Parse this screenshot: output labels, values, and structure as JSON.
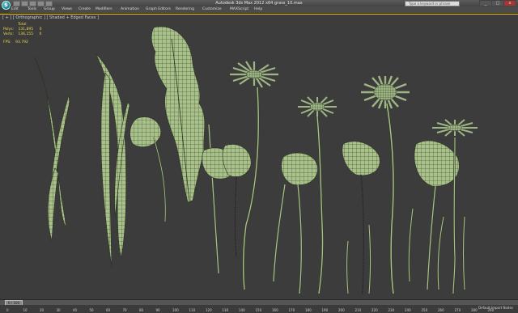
{
  "titlebar": {
    "app_logo_letter": "S",
    "title": "Autodesk 3ds Max 2012 x64    grass_10.max",
    "search_placeholder": "Type a keyword or phrase",
    "min_label": "_",
    "max_label": "□",
    "close_label": "x"
  },
  "menubar": {
    "items": [
      "Edit",
      "Tools",
      "Group",
      "Views",
      "Create",
      "Modifiers",
      "Animation",
      "Graph Editors",
      "Rendering",
      "Customize",
      "MAXScript",
      "Help"
    ]
  },
  "viewport": {
    "label": "[ + ] [ Orthographic ] [ Shaded + Edged Faces ]",
    "stats": {
      "total_label": "Total",
      "polys_label": "Polys:",
      "polys_value": "131,895",
      "polys_sel": "0",
      "verts_label": "Verts:",
      "verts_value": "136,155",
      "verts_sel": "0",
      "fps_label": "FPS:",
      "fps_value": "93.792"
    }
  },
  "timebar": {
    "slider_label": "0 / 100"
  },
  "trackbar": {
    "ticks": [
      "0",
      "10",
      "20",
      "30",
      "40",
      "50",
      "60",
      "70",
      "80",
      "90",
      "100",
      "110",
      "120",
      "130",
      "140",
      "150",
      "160",
      "170",
      "180",
      "190",
      "200",
      "210",
      "220",
      "230",
      "240",
      "250",
      "260",
      "270",
      "280",
      "290"
    ],
    "status_right": "Default Import Nodes"
  },
  "colors": {
    "leaf": "#a8c089",
    "wire": "#2a3320",
    "background": "#3c3c3c",
    "stats": "#e8d84a"
  }
}
